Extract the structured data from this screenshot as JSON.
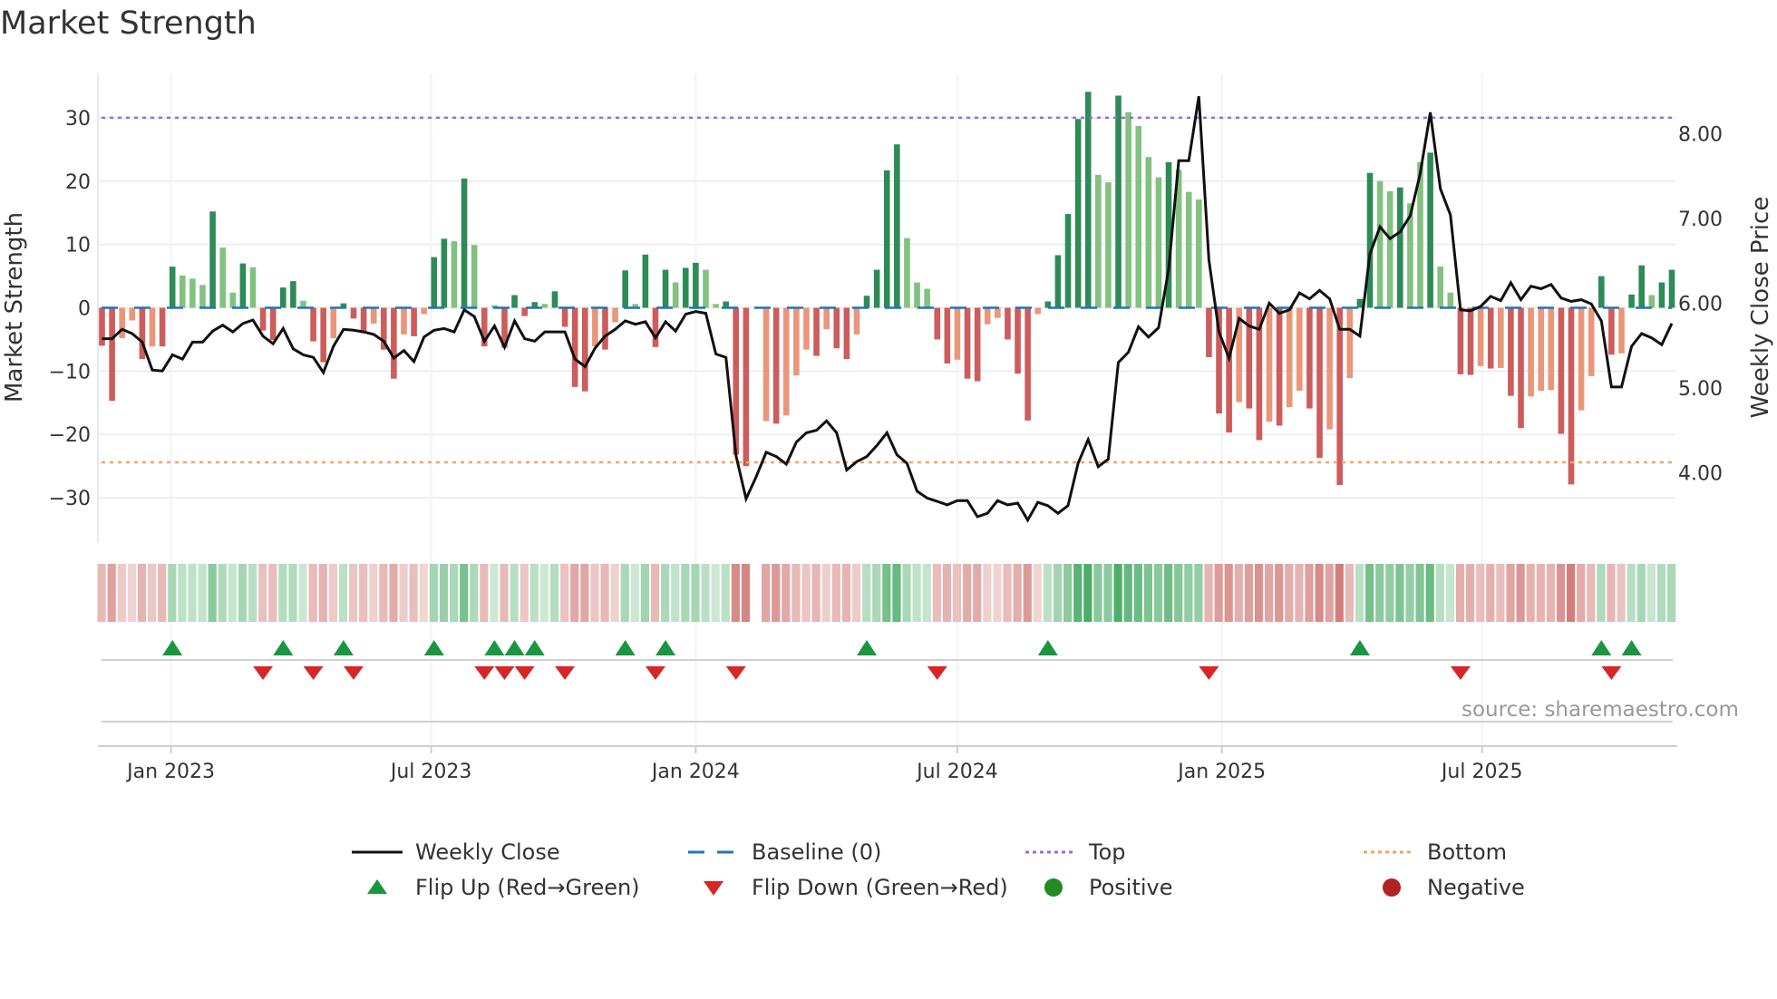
{
  "title": "Market Strength",
  "source": "source: sharemaestro.com",
  "legend": [
    {
      "label": "Weekly Close",
      "icon": "line"
    },
    {
      "label": "Baseline (0)",
      "icon": "dashed-line"
    },
    {
      "label": "Top",
      "icon": "dotted-line"
    },
    {
      "label": "Bottom",
      "icon": "dotted-line"
    },
    {
      "label": "Flip Up (Red→Green)",
      "icon": "triangle-up"
    },
    {
      "label": "Flip Down (Green→Red)",
      "icon": "triangle-down"
    },
    {
      "label": "Positive",
      "icon": "circle"
    },
    {
      "label": "Negative",
      "icon": "circle"
    }
  ],
  "colors": {
    "strong_pos": "#2e8b57",
    "weak_pos": "#82c17f",
    "strong_neg": "#cd5c5c",
    "weak_neg": "#e9967a",
    "line": "#111111",
    "baseline": "#1f77b4",
    "top": "#9370db",
    "bottom": "#f4a460",
    "flip_up": "#1a9641",
    "flip_down": "#d62728",
    "positive": "#228b22",
    "negative": "#b22222",
    "grid": "#eceef3"
  },
  "chart_data": {
    "type": "bar",
    "title": "Market Strength",
    "ylabel": "Market Strength",
    "y2label": "Weekly Close Price",
    "ylim": [
      -37,
      37
    ],
    "y2lim": [
      3.18,
      8.71
    ],
    "yticks": [
      -30,
      -20,
      -10,
      0,
      10,
      20,
      30
    ],
    "ytick_labels": [
      "−30",
      "−20",
      "−10",
      "0",
      "10",
      "20",
      "30"
    ],
    "y2ticks": [
      4,
      5,
      6,
      7,
      8
    ],
    "y2tick_labels": [
      "4.00",
      "5.00",
      "6.00",
      "7.00",
      "8.00"
    ],
    "x_start": "2022-11-14",
    "x_step_days": 7,
    "xticks": [
      {
        "date": "2023-01-01",
        "label": "Jan 2023"
      },
      {
        "date": "2023-07-01",
        "label": "Jul 2023"
      },
      {
        "date": "2024-01-01",
        "label": "Jan 2024"
      },
      {
        "date": "2024-07-01",
        "label": "Jul 2024"
      },
      {
        "date": "2025-01-01",
        "label": "Jan 2025"
      },
      {
        "date": "2025-07-01",
        "label": "Jul 2025"
      }
    ],
    "top_level": 30,
    "bottom_level": -24.4,
    "baseline": 0,
    "strength": [
      -6.0,
      -14.7,
      -4.8,
      -2.0,
      -8.1,
      -6.1,
      -6.1,
      6.5,
      5.1,
      4.6,
      3.6,
      15.2,
      9.5,
      2.4,
      7.0,
      6.4,
      -3.6,
      -5.1,
      3.2,
      4.2,
      1.1,
      -5.3,
      -8.6,
      -4.8,
      0.7,
      -1.7,
      -4.0,
      -2.5,
      -6.6,
      -11.2,
      -4.2,
      -4.5,
      -1.0,
      8.0,
      10.9,
      10.5,
      20.4,
      9.9,
      -6.1,
      0.4,
      -6.3,
      2.0,
      -1.3,
      0.9,
      0.6,
      2.6,
      -3.0,
      -12.5,
      -13.2,
      -6.1,
      -6.6,
      -2.3,
      5.9,
      0.6,
      8.4,
      -6.2,
      6.0,
      4.0,
      6.3,
      7.1,
      6.0,
      0.6,
      1.0,
      -23.2,
      -25.0,
      null,
      -17.9,
      -18.3,
      -17.0,
      -10.7,
      -6.6,
      -7.6,
      -3.4,
      -6.4,
      -8.1,
      -4.2,
      1.9,
      6.0,
      21.7,
      25.8,
      11.0,
      4.0,
      3.0,
      -5.0,
      -8.8,
      -8.2,
      -11.2,
      -11.6,
      -2.6,
      -1.6,
      -5.0,
      -10.4,
      -17.8,
      -1.0,
      1.0,
      8.3,
      14.8,
      29.8,
      34.1,
      21.0,
      19.8,
      33.5,
      30.9,
      28.7,
      23.8,
      20.6,
      23.0,
      21.8,
      18.3,
      17.1,
      -7.8,
      -16.7,
      -19.7,
      -14.9,
      -15.9,
      -20.9,
      -18.0,
      -18.6,
      -15.7,
      -13.1,
      -15.9,
      -23.7,
      -19.2,
      -28.0,
      -11.1,
      1.4,
      21.3,
      20.0,
      18.4,
      19.0,
      16.5,
      23.0,
      24.5,
      6.5,
      2.4,
      -10.5,
      -10.6,
      -9.2,
      -9.6,
      -9.5,
      -13.9,
      -19.0,
      -14.0,
      -13.1,
      -13.0,
      -19.9,
      -27.9,
      -16.2,
      -10.8,
      5.0,
      -7.4,
      -7.2,
      2.1,
      6.7,
      2.0,
      4.0,
      6.0
    ],
    "strong": [
      1,
      1,
      0,
      0,
      1,
      0,
      1,
      1,
      0,
      0,
      0,
      1,
      0,
      0,
      1,
      0,
      1,
      1,
      1,
      1,
      0,
      1,
      1,
      0,
      1,
      1,
      1,
      0,
      1,
      1,
      0,
      1,
      0,
      1,
      1,
      0,
      1,
      0,
      1,
      0,
      1,
      1,
      1,
      1,
      0,
      1,
      1,
      1,
      1,
      0,
      1,
      0,
      1,
      0,
      1,
      1,
      1,
      0,
      1,
      1,
      0,
      0,
      1,
      1,
      1,
      0,
      0,
      1,
      0,
      0,
      0,
      1,
      0,
      1,
      1,
      0,
      1,
      1,
      1,
      1,
      0,
      0,
      0,
      1,
      1,
      0,
      1,
      1,
      0,
      0,
      1,
      1,
      1,
      0,
      1,
      1,
      1,
      1,
      1,
      0,
      0,
      1,
      0,
      0,
      0,
      0,
      1,
      0,
      0,
      0,
      1,
      1,
      1,
      0,
      1,
      1,
      0,
      1,
      0,
      0,
      1,
      1,
      0,
      1,
      0,
      1,
      1,
      0,
      0,
      1,
      0,
      0,
      1,
      0,
      0,
      1,
      1,
      0,
      1,
      0,
      1,
      1,
      0,
      0,
      0,
      1,
      1,
      0,
      0,
      1,
      1,
      0,
      1,
      1,
      0,
      1,
      1
    ],
    "weekly_close": [
      5.58,
      5.58,
      5.69,
      5.64,
      5.54,
      5.21,
      5.2,
      5.39,
      5.34,
      5.54,
      5.54,
      5.67,
      5.74,
      5.66,
      5.76,
      5.8,
      5.61,
      5.52,
      5.7,
      5.46,
      5.39,
      5.36,
      5.18,
      5.49,
      5.69,
      5.68,
      5.66,
      5.63,
      5.55,
      5.35,
      5.44,
      5.31,
      5.6,
      5.68,
      5.7,
      5.66,
      5.92,
      5.84,
      5.55,
      5.73,
      5.48,
      5.79,
      5.58,
      5.55,
      5.66,
      5.66,
      5.66,
      5.34,
      5.25,
      5.47,
      5.61,
      5.69,
      5.79,
      5.75,
      5.78,
      5.59,
      5.78,
      5.67,
      5.87,
      5.9,
      5.88,
      5.4,
      5.36,
      4.2,
      3.69,
      3.95,
      4.24,
      4.19,
      4.1,
      4.36,
      4.47,
      4.5,
      4.61,
      4.47,
      4.03,
      4.13,
      4.19,
      4.32,
      4.47,
      4.21,
      4.11,
      3.78,
      3.7,
      3.66,
      3.62,
      3.67,
      3.67,
      3.48,
      3.52,
      3.67,
      3.62,
      3.64,
      3.44,
      3.65,
      3.61,
      3.52,
      3.61,
      4.11,
      4.39,
      4.07,
      4.16,
      5.3,
      5.42,
      5.72,
      5.6,
      5.71,
      6.4,
      7.68,
      7.68,
      8.44,
      6.51,
      5.66,
      5.35,
      5.82,
      5.73,
      5.69,
      6.0,
      5.88,
      5.92,
      6.12,
      6.05,
      6.15,
      6.05,
      5.69,
      5.69,
      5.61,
      6.58,
      6.9,
      6.76,
      6.84,
      7.03,
      7.53,
      8.25,
      7.35,
      7.04,
      5.92,
      5.91,
      5.96,
      6.08,
      6.03,
      6.24,
      6.04,
      6.2,
      6.17,
      6.22,
      6.06,
      6.02,
      6.04,
      5.99,
      5.79,
      5.01,
      5.01,
      5.49,
      5.64,
      5.59,
      5.51,
      5.76
    ],
    "flip_up_weeks": [
      7,
      18,
      24,
      33,
      39,
      41,
      43,
      52,
      56,
      76,
      94,
      125,
      149,
      152
    ],
    "flip_down_weeks": [
      16,
      21,
      25,
      38,
      40,
      42,
      46,
      55,
      63,
      83,
      110,
      135,
      150
    ],
    "grid": true,
    "legend_position": "bottom"
  }
}
